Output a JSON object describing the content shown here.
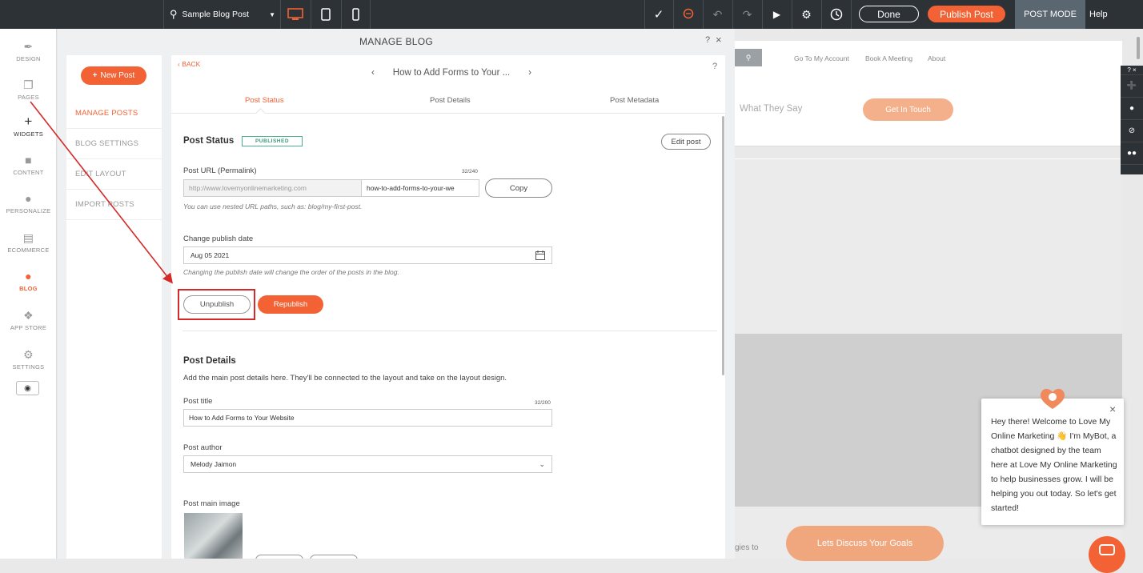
{
  "topbar": {
    "page_selector": "Sample Blog Post",
    "done_label": "Done",
    "publish_label": "Publish Post",
    "mode_label": "POST MODE",
    "help_label": "Help"
  },
  "rail": {
    "items": [
      {
        "label": "DESIGN",
        "icon": "brush-icon"
      },
      {
        "label": "PAGES",
        "icon": "pages-icon"
      },
      {
        "label": "WIDGETS",
        "icon": "plus-icon"
      },
      {
        "label": "CONTENT",
        "icon": "folder-icon"
      },
      {
        "label": "PERSONALIZE",
        "icon": "person-icon"
      },
      {
        "label": "ECOMMERCE",
        "icon": "cart-icon"
      },
      {
        "label": "BLOG",
        "icon": "blog-icon"
      },
      {
        "label": "APP STORE",
        "icon": "puzzle-icon"
      },
      {
        "label": "SETTINGS",
        "icon": "gear-icon"
      }
    ]
  },
  "panel": {
    "title": "MANAGE BLOG",
    "new_post_label": "New Post",
    "subnav": [
      "MANAGE POSTS",
      "BLOG SETTINGS",
      "EDIT LAYOUT",
      "IMPORT POSTS"
    ],
    "back_label": "BACK",
    "current_post": "How to Add Forms to Your ...",
    "tabs": [
      "Post Status",
      "Post Details",
      "Post Metadata"
    ]
  },
  "post_status": {
    "heading": "Post Status",
    "badge": "PUBLISHED",
    "edit_label": "Edit post",
    "url_label": "Post URL (Permalink)",
    "url_count": "32/240",
    "url_prefix": "http://www.lovemyonlinemarketing.com",
    "url_slug": "how-to-add-forms-to-your-we",
    "copy_label": "Copy",
    "url_hint": "You can use nested URL paths, such as: blog/my-first-post.",
    "date_label": "Change publish date",
    "date_value": "Aug 05 2021",
    "date_hint": "Changing the publish date will change the order of the posts in the blog.",
    "unpublish_label": "Unpublish",
    "republish_label": "Republish"
  },
  "post_details": {
    "heading": "Post Details",
    "description": "Add the main post details here. They'll be connected to the layout and take on the layout design.",
    "title_label": "Post title",
    "title_count": "32/200",
    "title_value": "How to Add Forms to Your Website",
    "author_label": "Post author",
    "author_value": "Melody Jaimon",
    "image_label": "Post main image"
  },
  "site": {
    "links": [
      "Go To My Account",
      "Book A Meeting",
      "About"
    ],
    "tagline": "What They Say",
    "cta": "Get In Touch",
    "cta2": "Lets Discuss Your Goals",
    "bottom_text": "gies to"
  },
  "chat": {
    "message": "Hey there! Welcome to Love My Online Marketing 👋 I'm MyBot, a chatbot designed by the team here at Love My Online Marketing to help businesses grow. I will be helping you out today. So let's get started!"
  },
  "colors": {
    "accent": "#f26235",
    "topbar": "#2d3236",
    "highlight": "#d42a2a",
    "published": "#3a9a74"
  }
}
